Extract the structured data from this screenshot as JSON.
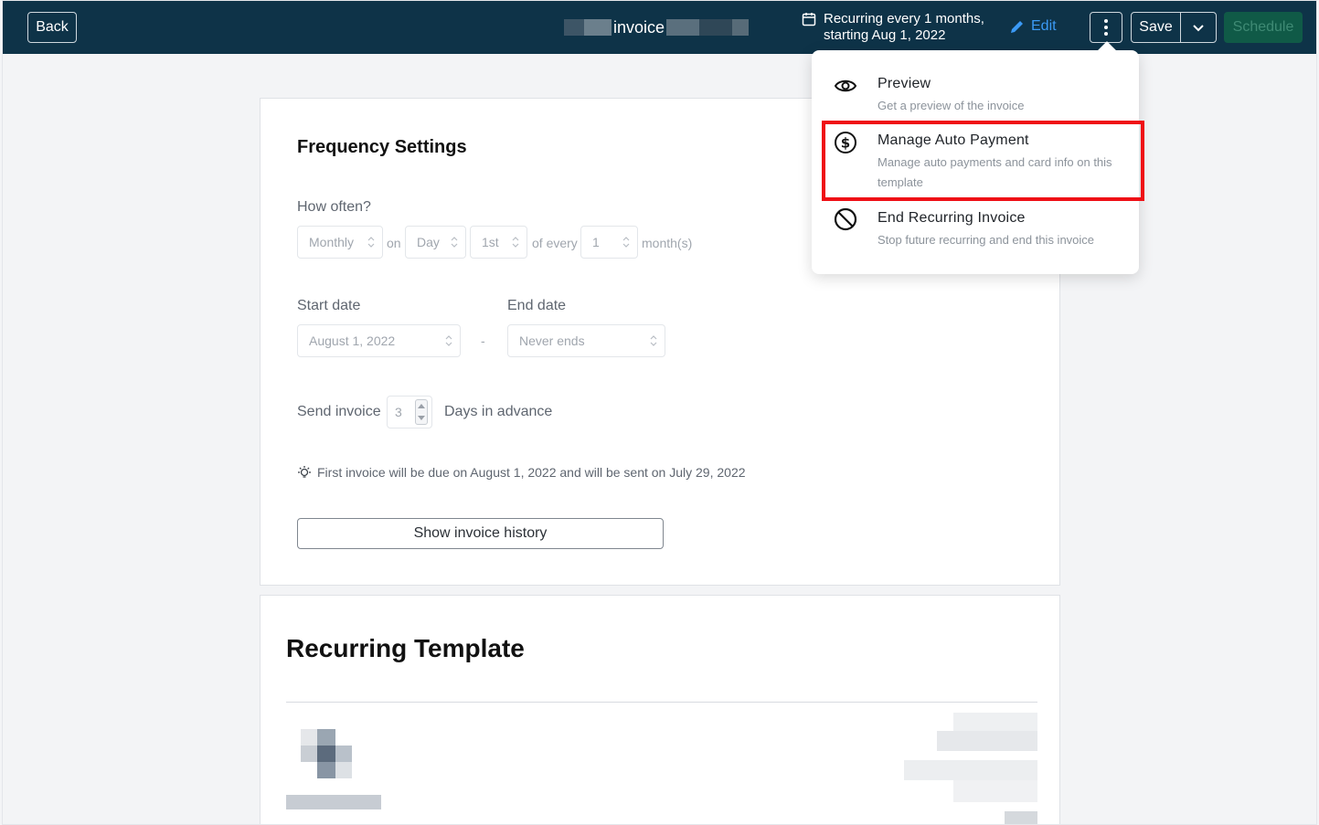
{
  "topbar": {
    "back_label": "Back",
    "title": "invoice",
    "recurrence_line1": "Recurring every 1 months,",
    "recurrence_line2": "starting Aug 1, 2022",
    "edit_label": "Edit",
    "save_label": "Save",
    "schedule_label": "Schedule"
  },
  "frequency": {
    "heading": "Frequency Settings",
    "how_often_label": "How often?",
    "frequency_value": "Monthly",
    "on_text": "on",
    "day_value": "Day",
    "ordinal_value": "1st",
    "of_every_text": "of every",
    "interval_value": "1",
    "unit_text": "month(s)",
    "start_date_label": "Start date",
    "start_date_value": "August 1, 2022",
    "range_separator": "-",
    "end_date_label": "End date",
    "end_date_value": "Never ends",
    "send_invoice_label": "Send invoice",
    "days_value": "3",
    "days_in_advance_label": "Days in advance",
    "tip_text": "First invoice will be due on August 1, 2022 and will be sent on July 29, 2022",
    "history_button": "Show invoice history"
  },
  "template": {
    "heading": "Recurring Template"
  },
  "menu": {
    "items": [
      {
        "title": "Preview",
        "description": "Get a preview of the invoice",
        "icon": "eye-icon"
      },
      {
        "title": "Manage Auto Payment",
        "description": "Manage auto payments and card info on this template",
        "icon": "dollar-circle-icon"
      },
      {
        "title": "End Recurring Invoice",
        "description": "Stop future recurring and end this invoice",
        "icon": "ban-icon"
      }
    ]
  },
  "colors": {
    "topbar": "#0e3348",
    "edit_link": "#3b9af5",
    "schedule_bg": "#105a47",
    "highlight": "#ef0f16"
  }
}
